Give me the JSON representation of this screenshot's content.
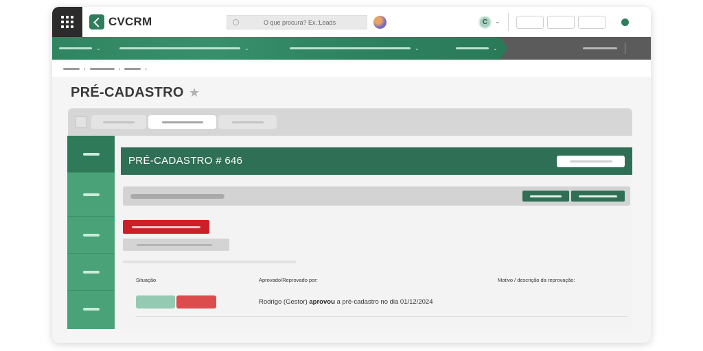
{
  "header": {
    "logo_text": "CVCRM",
    "search_placeholder": "O que procura? Ex.:Leads",
    "user_initial": "C",
    "brand_color": "#2e7d5b"
  },
  "page": {
    "title": "PRÉ-CADASTRO"
  },
  "record": {
    "title": "PRÉ-CADASTRO # 646"
  },
  "table": {
    "columns": [
      "Situação",
      "Aprovado/Reprovado por:",
      "Motivo / descrição da reprovação:"
    ],
    "approval": {
      "actor": "Rodrigo (Gestor)",
      "action": "aprovou",
      "rest": "a pré-cadastro no dia 01/12/2024"
    }
  },
  "colors": {
    "header_green": "#2e6f55",
    "side_green": "#4aa378",
    "alert_red": "#cc1f27"
  }
}
